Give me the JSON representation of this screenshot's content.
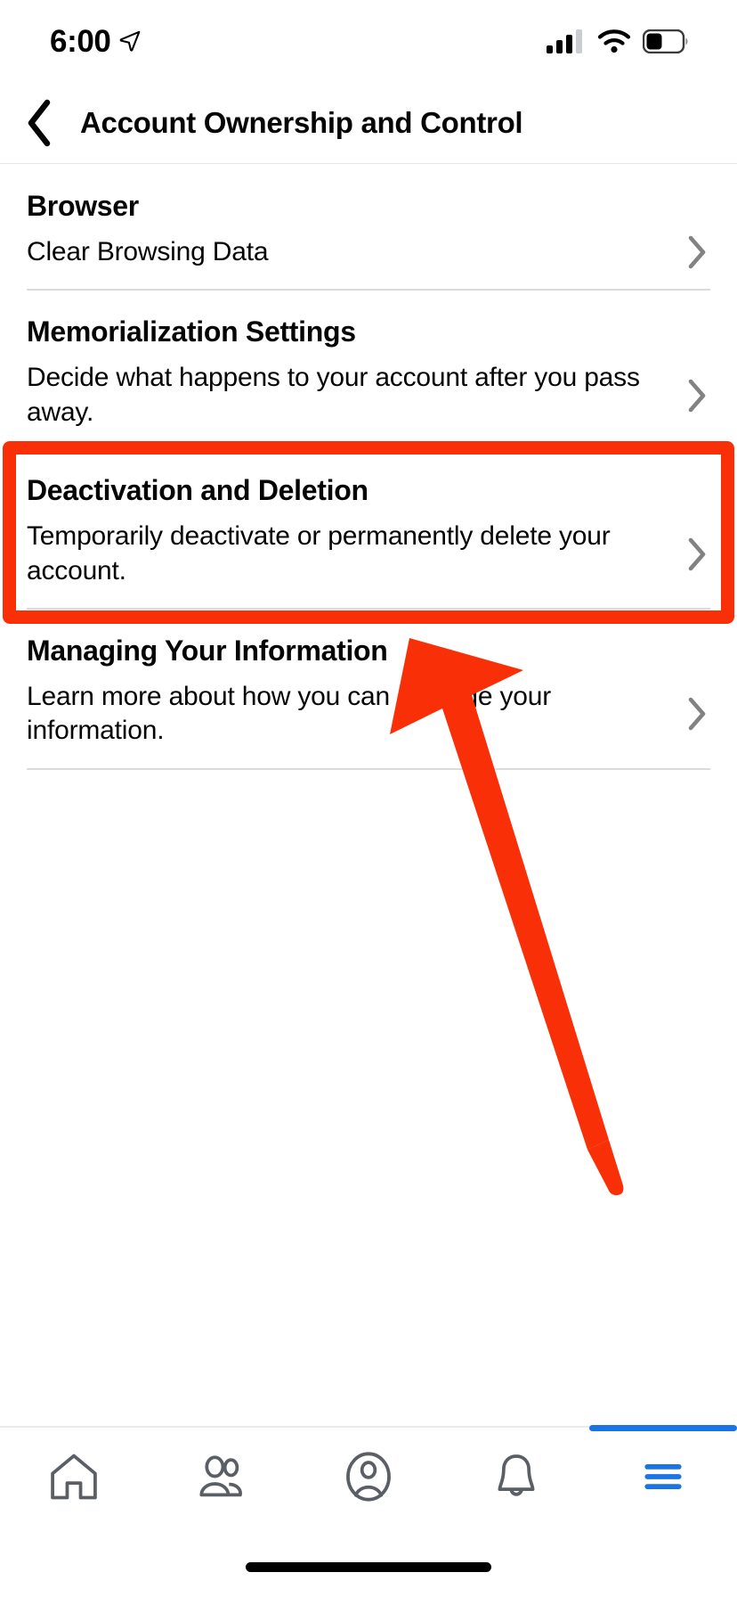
{
  "status_bar": {
    "time": "6:00",
    "location_icon": "location-arrow-icon",
    "cellular_icon": "cellular-signal-icon",
    "cellular_bars_filled": 3,
    "cellular_bars_total": 4,
    "wifi_icon": "wifi-icon",
    "battery_icon": "battery-icon",
    "battery_level_percent": 40
  },
  "header": {
    "back_icon": "chevron-left-icon",
    "title": "Account Ownership and Control"
  },
  "sections": [
    {
      "header": "Browser",
      "row_text": "Clear Browsing Data",
      "chevron_icon": "chevron-right-icon",
      "has_divider": true,
      "highlighted": false
    },
    {
      "header": "Memorialization Settings",
      "row_text": "Decide what happens to your account after you pass away.",
      "chevron_icon": "chevron-right-icon",
      "has_divider": false,
      "highlighted": false
    },
    {
      "header": "Deactivation and Deletion",
      "row_text": "Temporarily deactivate or permanently delete your account.",
      "chevron_icon": "chevron-right-icon",
      "has_divider": true,
      "highlighted": true
    },
    {
      "header": "Managing Your Information",
      "row_text": "Learn more about how you can manage your information.",
      "chevron_icon": "chevron-right-icon",
      "has_divider": true,
      "highlighted": false
    }
  ],
  "annotations": {
    "highlight_color": "#f92f08",
    "highlight_target": "Deactivation and Deletion",
    "arrow_color": "#f92f08",
    "arrow_points_to": "Deactivation and Deletion"
  },
  "tab_bar": {
    "active_index": 4,
    "active_color": "#1b74e4",
    "inactive_color": "#606770",
    "tabs": [
      {
        "name": "home-tab",
        "icon": "home-icon"
      },
      {
        "name": "friends-tab",
        "icon": "friends-icon"
      },
      {
        "name": "profile-tab",
        "icon": "profile-circle-icon"
      },
      {
        "name": "notifications-tab",
        "icon": "bell-icon"
      },
      {
        "name": "menu-tab",
        "icon": "hamburger-menu-icon"
      }
    ]
  }
}
